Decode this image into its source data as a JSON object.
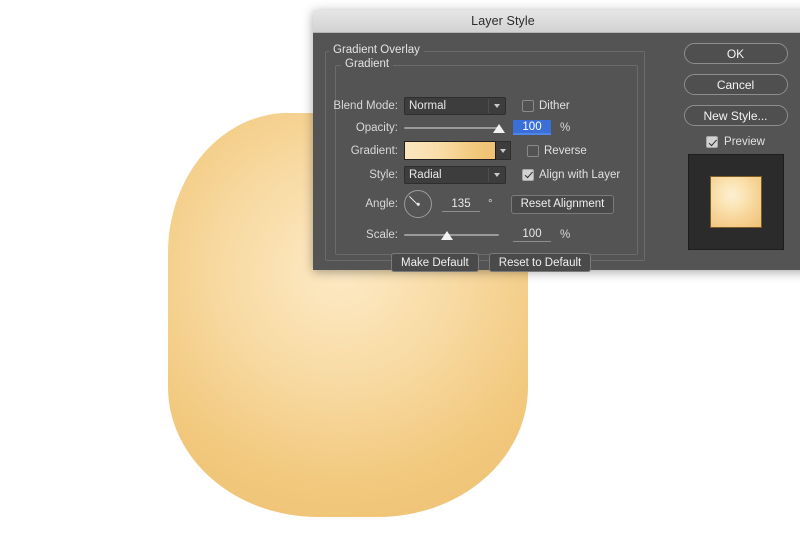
{
  "window": {
    "title": "Layer Style"
  },
  "sections": {
    "outer_label": "Gradient Overlay",
    "inner_label": "Gradient"
  },
  "fields": {
    "blend_mode": {
      "label": "Blend Mode:",
      "value": "Normal"
    },
    "opacity": {
      "label": "Opacity:",
      "value": "100",
      "unit": "%",
      "slider_pct": 100
    },
    "gradient": {
      "label": "Gradient:",
      "swatch_from": "#fbe6bf",
      "swatch_to": "#efc173"
    },
    "style": {
      "label": "Style:",
      "value": "Radial"
    },
    "angle": {
      "label": "Angle:",
      "value": "135",
      "unit": "°"
    },
    "scale": {
      "label": "Scale:",
      "value": "100",
      "unit": "%",
      "slider_pct": 45
    }
  },
  "checkboxes": {
    "dither": {
      "label": "Dither",
      "checked": false
    },
    "reverse": {
      "label": "Reverse",
      "checked": false
    },
    "align_with_layer": {
      "label": "Align with Layer",
      "checked": true
    },
    "preview": {
      "label": "Preview",
      "checked": true
    }
  },
  "buttons": {
    "reset_alignment": "Reset Alignment",
    "make_default": "Make Default",
    "reset_to_default": "Reset to Default",
    "ok": "OK",
    "cancel": "Cancel",
    "new_style": "New Style..."
  },
  "artwork": {
    "description": "rounded-square shape with radial gradient overlay",
    "center_color": "#fce9c4",
    "edge_color": "#eec173"
  },
  "colors": {
    "dialog_bg": "#545454",
    "titlebar_bg": "#e0e0e0",
    "field_bg": "#3d3d3d",
    "selection_blue": "#3a6fd8",
    "page_bg": "#ffffff"
  }
}
